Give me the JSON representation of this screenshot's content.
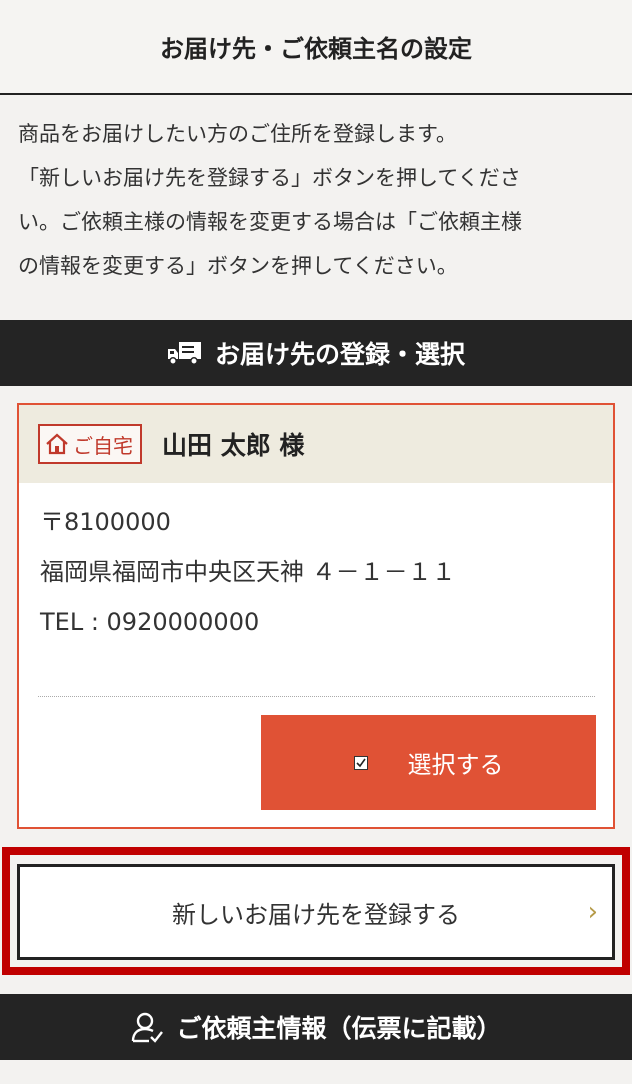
{
  "header": {
    "title": "お届け先・ご依頼主名の設定"
  },
  "intro": {
    "lines": [
      "商品をお届けしたい方のご住所を登録します。",
      "「新しいお届け先を登録する」ボタンを押してくださ",
      "い。ご依頼主様の情報を変更する場合は「ご依頼主様",
      "の情報を変更する」ボタンを押してください。"
    ]
  },
  "delivery_section": {
    "title": "お届け先の登録・選択",
    "icon": "truck-icon"
  },
  "address_card": {
    "tag_label": "ご自宅",
    "tag_icon": "home-icon",
    "name": "山田 太郎 様",
    "postal": "〒8100000",
    "address": "福岡県福岡市中央区天神 ４－１－１１",
    "tel": "TEL : 0920000000",
    "select_label": "選択する"
  },
  "new_address": {
    "label": "新しいお届け先を登録する",
    "chevron": "›"
  },
  "sender_section": {
    "title": "ご依頼主情報（伝票に記載）",
    "icon": "person-check-icon"
  },
  "colors": {
    "accent": "#e05235",
    "highlight": "#c00000",
    "dark_bar": "#242424",
    "chevron": "#b59a48"
  }
}
